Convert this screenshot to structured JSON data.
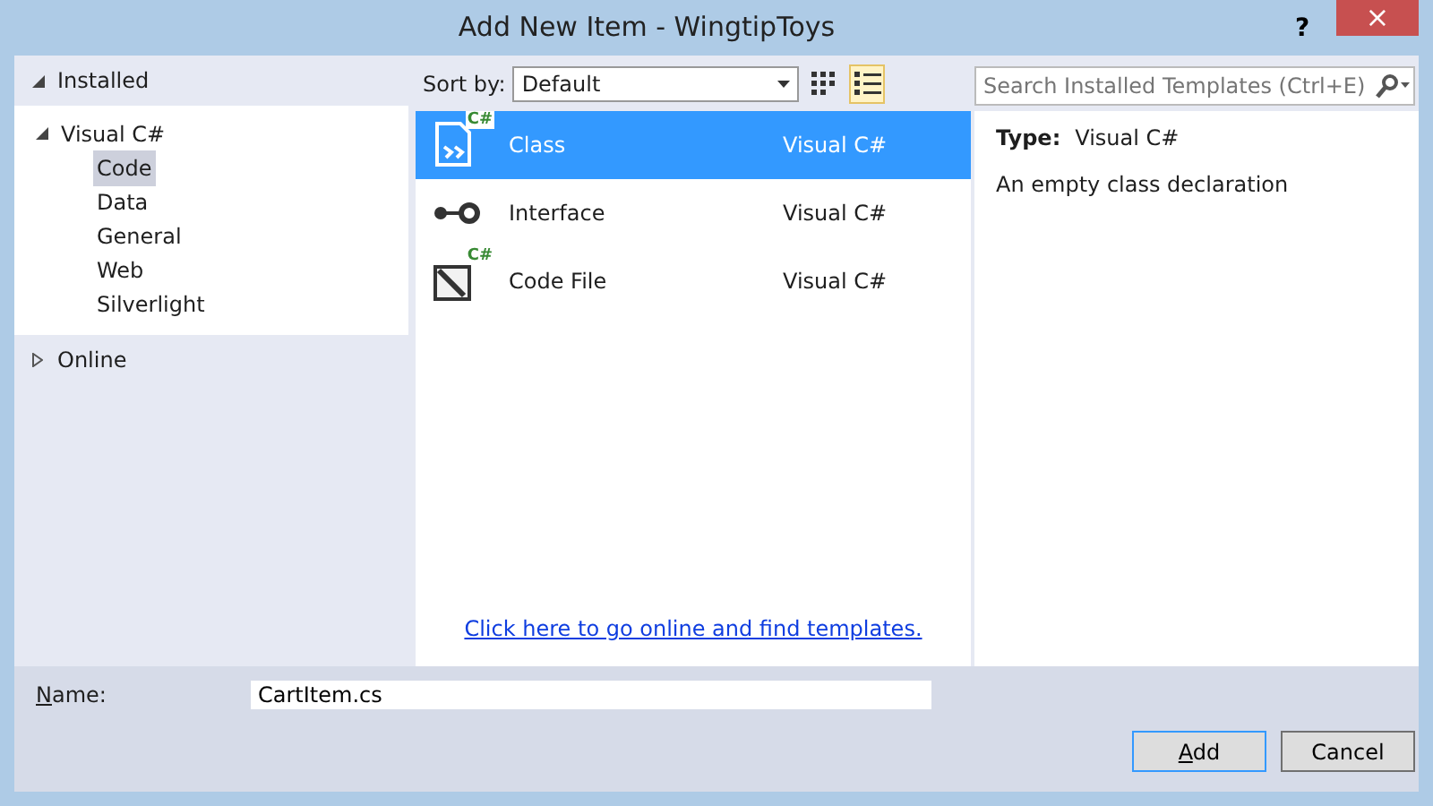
{
  "window": {
    "title": "Add New Item - WingtipToys",
    "help": "?",
    "close": "×"
  },
  "tree": [
    {
      "label": "Installed",
      "expanded": true,
      "selected": false,
      "children": [
        {
          "label": "Visual C#",
          "expanded": true,
          "selected": false,
          "children": [
            {
              "label": "Code",
              "selected": true
            },
            {
              "label": "Data",
              "selected": false
            },
            {
              "label": "General",
              "selected": false
            },
            {
              "label": "Web",
              "selected": false
            },
            {
              "label": "Silverlight",
              "selected": false
            }
          ]
        }
      ]
    },
    {
      "label": "Online",
      "expanded": false,
      "selected": false
    }
  ],
  "toolbar": {
    "sort_label": "Sort by:",
    "sort_value": "Default",
    "views": [
      {
        "kind": "grid",
        "selected": false
      },
      {
        "kind": "list",
        "selected": true
      }
    ]
  },
  "search": {
    "placeholder": "Search Installed Templates (Ctrl+E)"
  },
  "templates": [
    {
      "kind": "class",
      "badge": "C#",
      "name": "Class",
      "language": "Visual C#",
      "selected": true
    },
    {
      "kind": "interface",
      "name": "Interface",
      "language": "Visual C#",
      "selected": false
    },
    {
      "kind": "codefile",
      "badge": "C#",
      "name": "Code File",
      "language": "Visual C#",
      "selected": false
    }
  ],
  "online_link": "Click here to go online and find templates.",
  "details": {
    "type_label": "Type:",
    "type_value": "Visual C#",
    "description": "An empty class declaration"
  },
  "name_field": {
    "label": "Name:",
    "access_key": true,
    "value": "CartItem.cs"
  },
  "buttons": [
    {
      "label": "Add",
      "access_key": true,
      "default": true
    },
    {
      "label": "Cancel",
      "default": false
    }
  ]
}
